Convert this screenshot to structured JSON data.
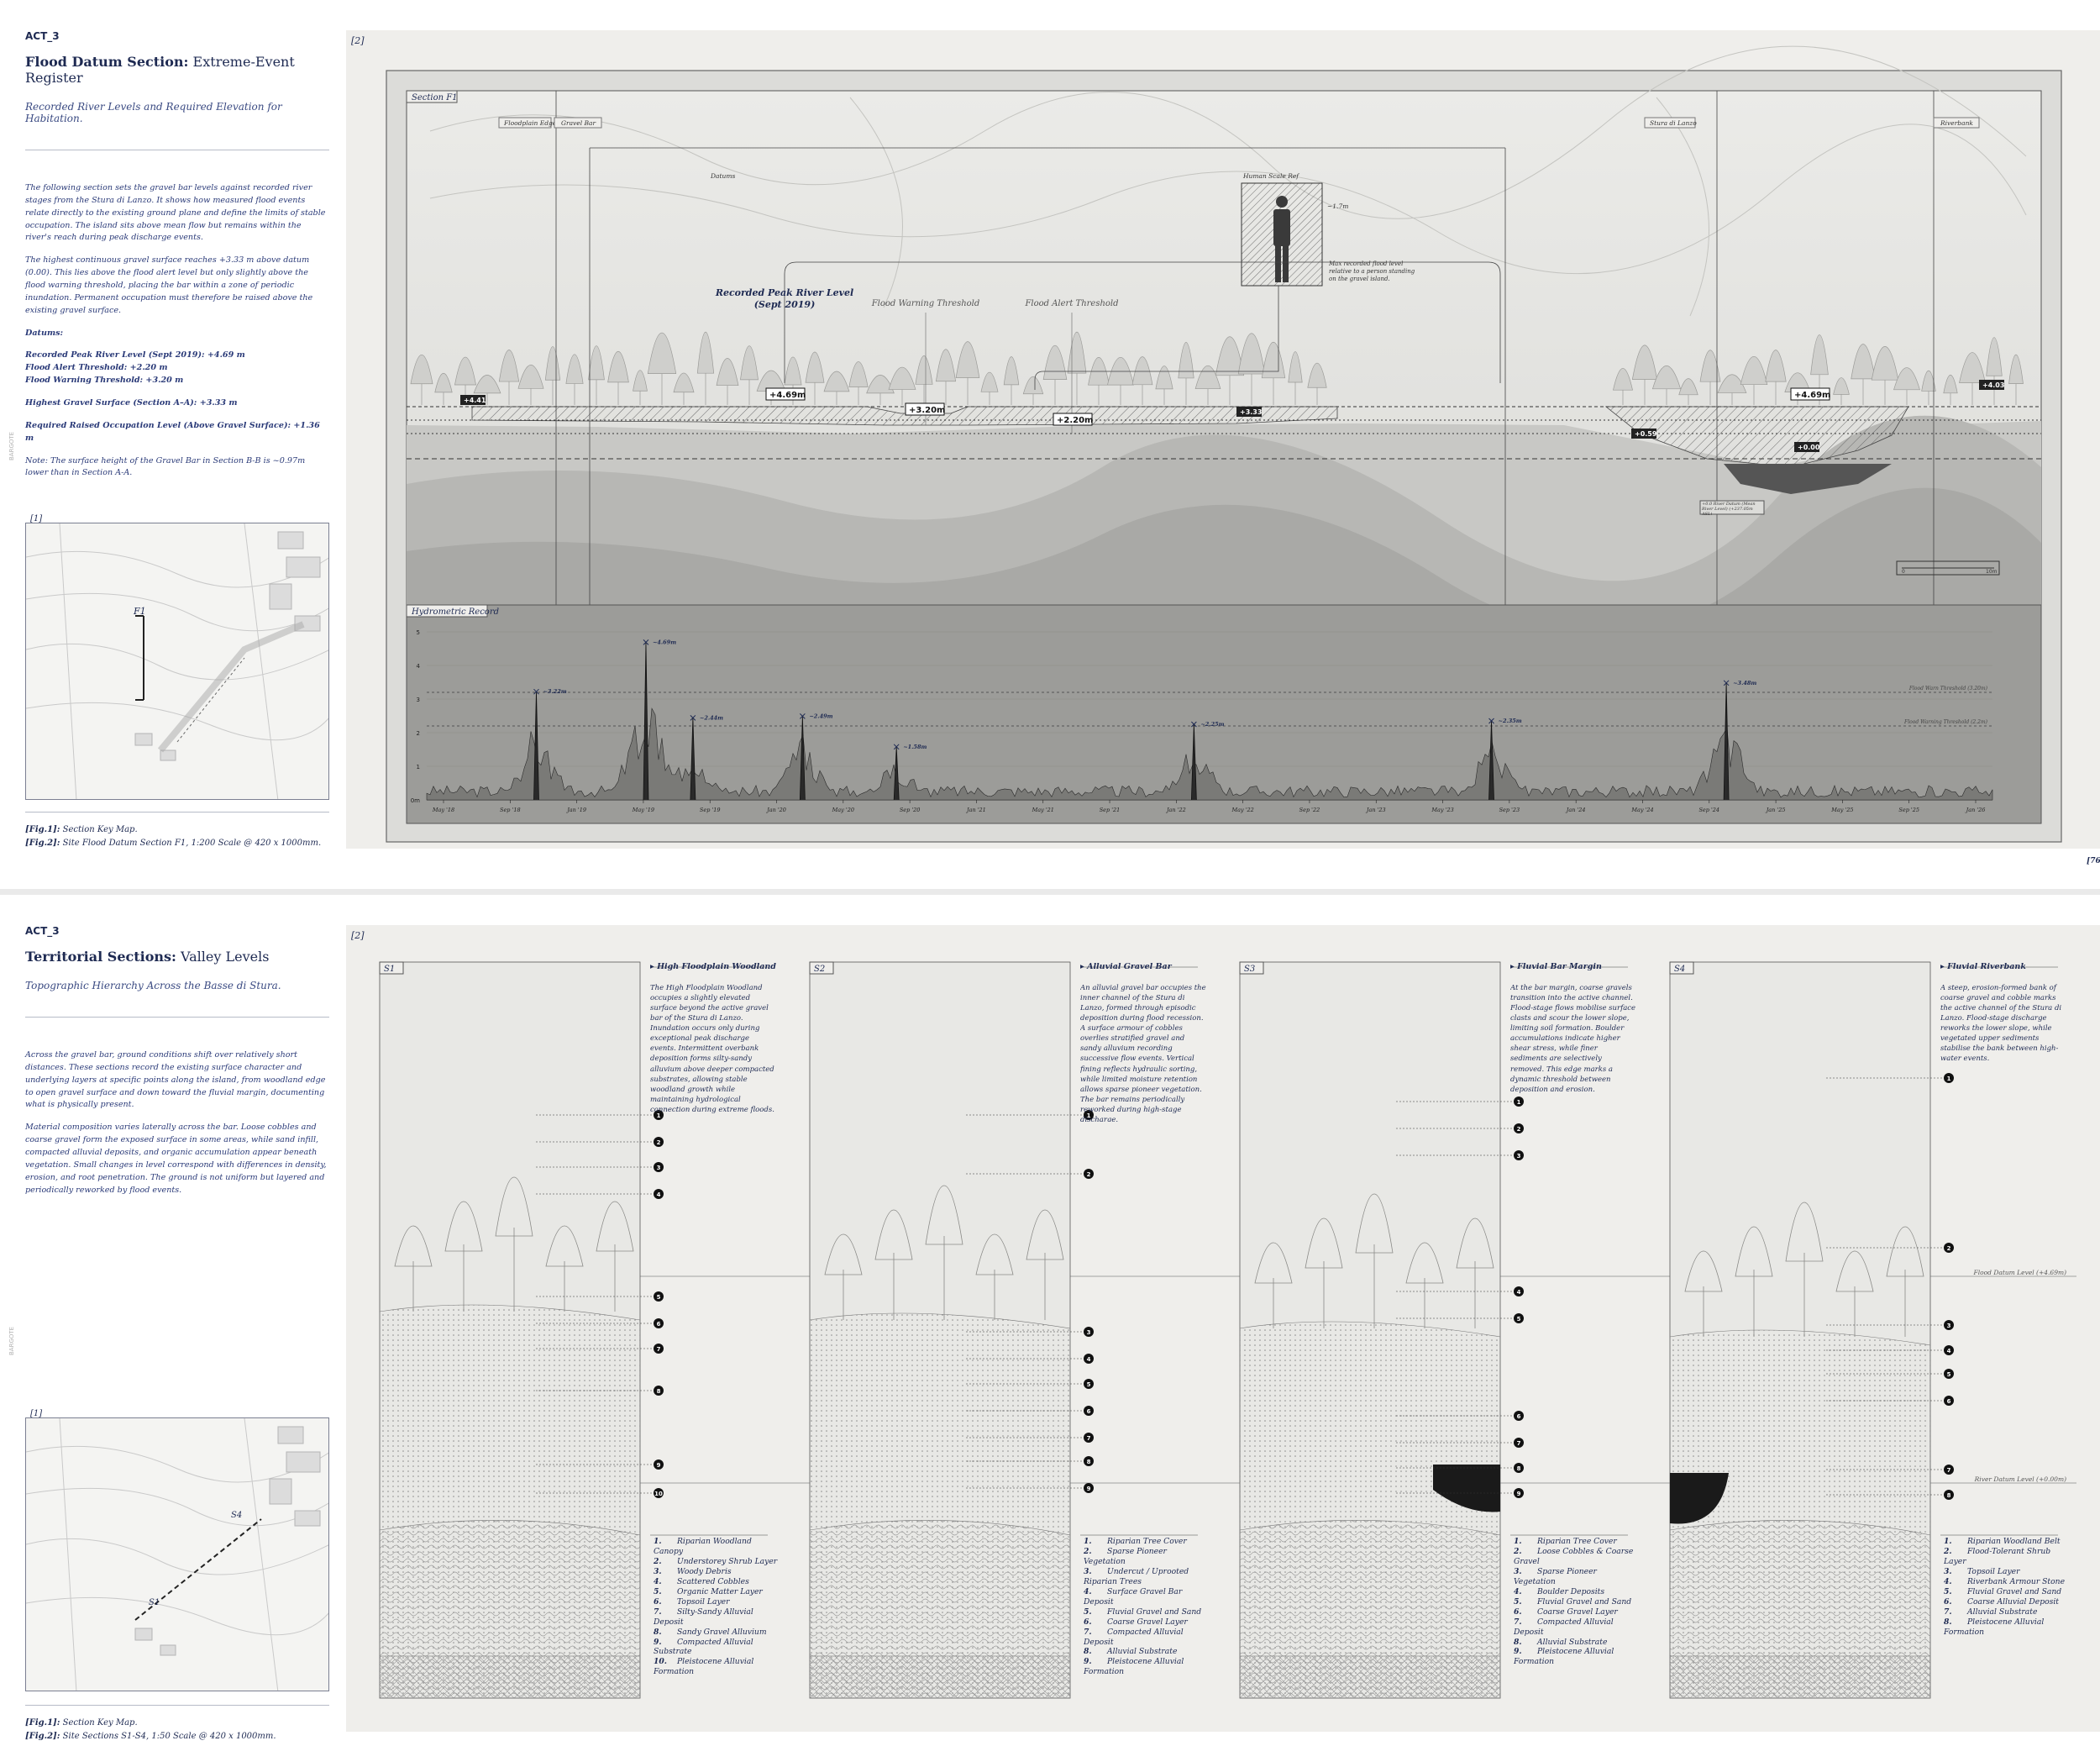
{
  "board1": {
    "act": "ACT_3",
    "title_bold": "Flood Datum Section:",
    "title_rest": " Extreme-Event Register",
    "subtitle": "Recorded River Levels and Required Elevation for Habitation.",
    "para1": "The following section sets the gravel bar levels against recorded river stages from the Stura di Lanzo. It shows how measured flood events relate directly to the existing ground plane and define the limits of stable occupation. The island sits above mean flow but remains within the river's reach during peak discharge events.",
    "para2": "The highest continuous gravel surface reaches +3.33 m above datum (0.00). This lies above the flood alert level but only slightly above the flood warning threshold, placing the bar within a zone of periodic inundation. Permanent occupation must therefore be raised above the existing gravel surface.",
    "datums_label": "Datums:",
    "datum1": "Recorded Peak River Level (Sept 2019): +4.69 m",
    "datum2": "Flood Alert Threshold: +2.20 m",
    "datum3": "Flood Warning Threshold: +3.20 m",
    "highest": "Highest Gravel Surface (Section A–A): +3.33 m",
    "required": "Required Raised Occupation Level (Above Gravel Surface): +1.36 m",
    "note": "Note: The surface height of the Gravel Bar in Section B-B is ~0.97m lower than in Section A-A.",
    "fig1_tag": "[1]",
    "fig2_tag": "[2]",
    "map_label": "F1",
    "caption1_tag": "[Fig.1]:",
    "caption1": " Section Key Map.",
    "caption2_tag": "[Fig.2]:",
    "caption2": " Site Flood Datum Section F1, 1:200 Scale @ 420 x 1000mm.",
    "page_num": "[76]",
    "vertical": "BARGOTE",
    "section": {
      "label": "Section F1",
      "tags": [
        "Floodplain Edge",
        "Gravel Bar",
        "Stura di Lanzo",
        "Riverbank"
      ],
      "datums_label": "Datums",
      "human_label": "Human Scale Ref",
      "human_height": "~1.7m",
      "human_note": "Max recorded flood level relative to a person standing on the gravel island.",
      "peak_label_1": "Recorded Peak River Level",
      "peak_label_2": "(Sept 2019)",
      "warning_label": "Flood Warning Threshold",
      "alert_label": "Flood Alert Threshold",
      "lv_peak": "+4.69m",
      "lv_warning": "+3.20m",
      "lv_alert": "+2.20m",
      "lv_left": "+4.41",
      "lv_mid": "+3.33",
      "lv_right_peak": "+4.69m",
      "lv_right_edge": "+4.03",
      "lv_bank": "+0.59",
      "lv_zero": "+0.00",
      "datum_note": "+0.0 River Datum (Mean River Level) (+237.05m ASL)",
      "scale_0": "0",
      "scale_end": "10m"
    },
    "hydro": {
      "label": "Hydrometric Record",
      "yticks": [
        "5",
        "4",
        "3",
        "2",
        "1",
        "0m"
      ],
      "xticks": [
        "May '18",
        "Sep '18",
        "Jan '19",
        "May '19",
        "Sep '19",
        "Jan '20",
        "May '20",
        "Sep '20",
        "Jan '21",
        "May '21",
        "Sep '21",
        "Jan '22",
        "May '22",
        "Sep '22",
        "Jan '23",
        "May '23",
        "Sep '23",
        "Jan '24",
        "May '24",
        "Sep '24",
        "Jan '25",
        "May '25",
        "Sep '25",
        "Jan '26"
      ],
      "warn_line": "Flood Warn Threshold (3.20m)",
      "alert_line": "Flood Warning Threshold (2.2m)"
    }
  },
  "chart_data": {
    "type": "area",
    "title": "Hydrometric Record",
    "ylabel": "",
    "ylim": [
      0,
      5
    ],
    "peaks": [
      {
        "x": "Aug '18",
        "y": 3.22,
        "label": "~3.22m"
      },
      {
        "x": "Sep '19",
        "y": 4.69,
        "label": "~4.69m"
      },
      {
        "x": "Dec '19",
        "y": 2.44,
        "label": "~2.44m"
      },
      {
        "x": "Oct '20",
        "y": 2.49,
        "label": "~2.49m"
      },
      {
        "x": "Jun '21",
        "y": 1.58,
        "label": "~1.58m"
      },
      {
        "x": "Jun '23",
        "y": 2.25,
        "label": "~2.25m"
      },
      {
        "x": "Jul '24",
        "y": 2.35,
        "label": "~2.35m"
      },
      {
        "x": "Jun '25",
        "y": 3.48,
        "label": "~3.48m"
      }
    ]
  },
  "board2": {
    "act": "ACT_3",
    "title_bold": "Territorial Sections:",
    "title_rest": " Valley Levels",
    "subtitle": "Topographic Hierarchy Across the Basse di Stura.",
    "para1": "Across the gravel bar, ground conditions shift over relatively short distances. These sections record the existing surface character and underlying layers at specific points along the island, from woodland edge to open gravel surface and down toward the fluvial margin, documenting what is physically present.",
    "para2": "Material composition varies laterally across the bar. Loose cobbles and coarse gravel form the exposed surface in some areas, while sand infill, compacted alluvial deposits, and organic accumulation appear beneath vegetation. Small changes in level correspond with differences in density, erosion, and root penetration. The ground is not uniform but layered and periodically reworked by flood events.",
    "fig1_tag": "[1]",
    "fig2_tag": "[2]",
    "map_label": "S1",
    "map_label2": "S4",
    "caption1_tag": "[Fig.1]:",
    "caption1": " Section Key Map.",
    "caption2_tag": "[Fig.2]:",
    "caption2": " Site Sections S1-S4, 1:50 Scale @ 420 x 1000mm.",
    "vertical": "BARGOTE",
    "flood_datum": "Flood Datum Level (+4.69m)",
    "river_datum": "River Datum Level (+0.00m)",
    "sections": [
      {
        "id": "S1",
        "title": "High Floodplain Woodland",
        "desc": "The High Floodplain Woodland occupies a slightly elevated surface beyond the active gravel bar of the Stura di Lanzo. Inundation occurs only during exceptional peak discharge events. Intermittent overbank deposition forms silty-sandy alluvium above deeper compacted substrates, allowing stable woodland growth while maintaining hydrological connection during extreme floods.",
        "legend": [
          "Riparian Woodland Canopy",
          "Understorey Shrub Layer",
          "Woody Debris",
          "Scattered Cobbles",
          "Organic Matter Layer",
          "Topsoil Layer",
          "Silty-Sandy Alluvial Deposit",
          "Sandy Gravel Alluvium",
          "Compacted Alluvial Substrate",
          "Pleistocene Alluvial Formation"
        ]
      },
      {
        "id": "S2",
        "title": "Alluvial Gravel Bar",
        "desc": "An alluvial gravel bar occupies the inner channel of the Stura di Lanzo, formed through episodic deposition during flood recession. A surface armour of cobbles overlies stratified gravel and sandy alluvium recording successive flow events. Vertical fining reflects hydraulic sorting, while limited moisture retention allows sparse pioneer vegetation. The bar remains periodically reworked during high-stage discharge.",
        "legend": [
          "Riparian Tree Cover",
          "Sparse Pioneer Vegetation",
          "Undercut / Uprooted Riparian Trees",
          "Surface Gravel Bar Deposit",
          "Fluvial Gravel and Sand",
          "Coarse Gravel Layer",
          "Compacted Alluvial Deposit",
          "Alluvial Substrate",
          "Pleistocene Alluvial Formation"
        ]
      },
      {
        "id": "S3",
        "title": "Fluvial Bar Margin",
        "desc": "At the bar margin, coarse gravels transition into the active channel. Flood-stage flows mobilise surface clasts and scour the lower slope, limiting soil formation. Boulder accumulations indicate higher shear stress, while finer sediments are selectively removed. This edge marks a dynamic threshold between deposition and erosion.",
        "legend": [
          "Riparian Tree Cover",
          "Loose Cobbles & Coarse Gravel",
          "Sparse Pioneer Vegetation",
          "Boulder Deposits",
          "Fluvial Gravel and Sand",
          "Coarse Gravel Layer",
          "Compacted Alluvial Deposit",
          "Alluvial Substrate",
          "Pleistocene Alluvial Formation"
        ]
      },
      {
        "id": "S4",
        "title": "Fluvial Riverbank",
        "desc": "A steep, erosion-formed bank of coarse gravel and cobble marks the active channel of the Stura di Lanzo. Flood-stage discharge reworks the lower slope, while vegetated upper sediments stabilise the bank between high-water events.",
        "legend": [
          "Riparian Woodland Belt",
          "Flood-Tolerant Shrub Layer",
          "Topsoil Layer",
          "Riverbank Armour Stone",
          "Fluvial Gravel and Sand",
          "Coarse Alluvial Deposit",
          "Alluvial Substrate",
          "Pleistocene Alluvial Formation"
        ]
      }
    ]
  }
}
